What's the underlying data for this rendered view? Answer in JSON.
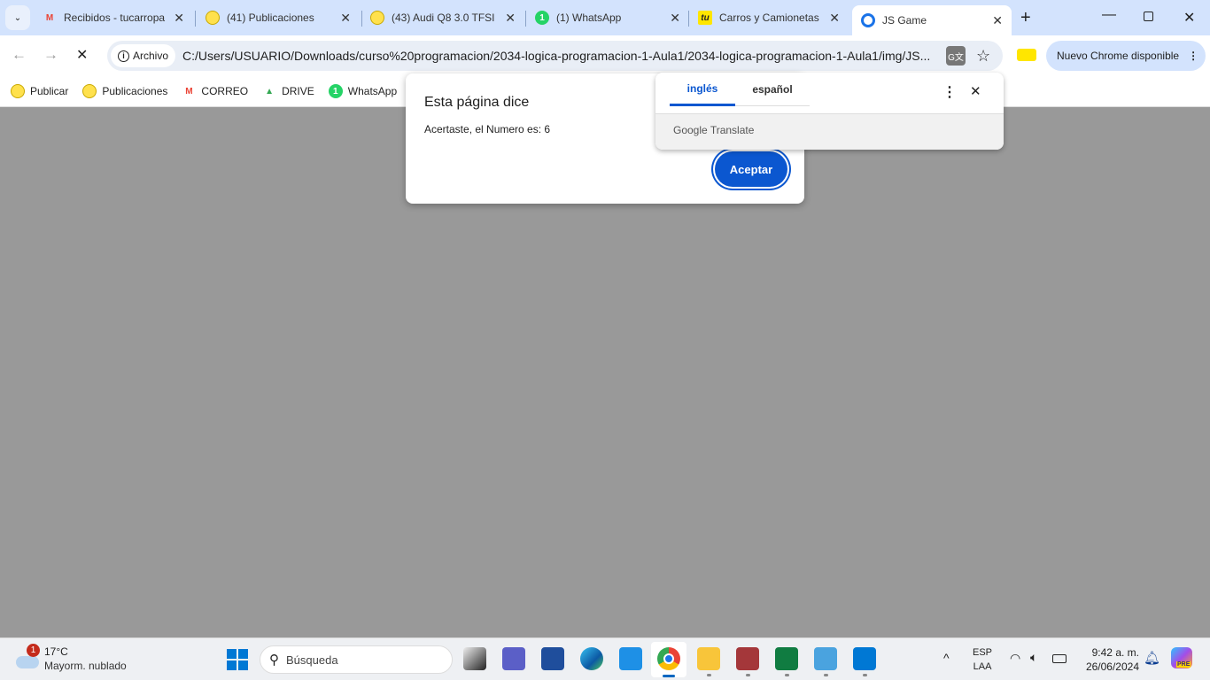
{
  "tabs": [
    {
      "title": "Recibidos - tucarropa",
      "icon": "gmail-icon",
      "color": "#ea4335"
    },
    {
      "title": "(41) Publicaciones",
      "icon": "mercadolibre-icon",
      "color": "#e6c200"
    },
    {
      "title": "(43) Audi Q8 3.0 TFSI",
      "icon": "mercadolibre-icon",
      "color": "#e6c200"
    },
    {
      "title": "(1) WhatsApp",
      "icon": "whatsapp-icon",
      "color": "#25d366",
      "badge": "1"
    },
    {
      "title": "Carros y Camionetas",
      "icon": "tucarro-icon",
      "color": "#ffe600",
      "badge": "tu"
    },
    {
      "title": "JS Game",
      "icon": "js-game-icon",
      "color": "#1a73e8",
      "active": true
    }
  ],
  "toolbar": {
    "chip": "Archivo",
    "url": "C:/Users/USUARIO/Downloads/curso%20programacion/2034-logica-programacion-1-Aula1/2034-logica-programacion-1-Aula1/img/JS...",
    "update": "Nuevo Chrome disponible"
  },
  "bookmarks": [
    {
      "label": "Publicar",
      "icon": "mercadolibre-icon"
    },
    {
      "label": "Publicaciones",
      "icon": "mercadolibre-icon"
    },
    {
      "label": "CORREO",
      "icon": "gmail-icon"
    },
    {
      "label": "DRIVE",
      "icon": "drive-icon"
    },
    {
      "label": "WhatsApp",
      "icon": "whatsapp-icon"
    }
  ],
  "dialog": {
    "title": "Esta página dice",
    "message": "Acertaste, el Numero es: 6",
    "ok": "Aceptar"
  },
  "translate": {
    "tabs": [
      "inglés",
      "español"
    ],
    "active": 0,
    "brand": "Google Translate"
  },
  "taskbar": {
    "weather_temp": "17°C",
    "weather_desc": "Mayorm. nublado",
    "weather_badge": "1",
    "search": "Búsqueda",
    "lang1": "ESP",
    "lang2": "LAA",
    "time": "9:42 a. m.",
    "date": "26/06/2024",
    "copilot_badge": "PRE"
  }
}
